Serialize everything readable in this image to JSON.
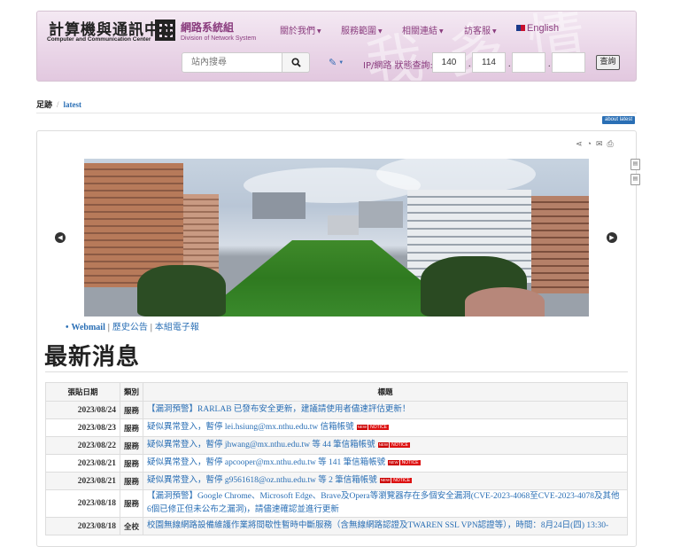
{
  "header": {
    "logo_zh": "計算機與通訊中心",
    "logo_en": "Computer and Communication Center",
    "division_zh": "網路系統組",
    "division_en": "Division of Network System",
    "watermark": "我 多 情",
    "nav": [
      {
        "label": "關於我們",
        "icon": "caret-down-icon"
      },
      {
        "label": "服務範圍",
        "icon": "caret-down-icon"
      },
      {
        "label": "相關連結",
        "icon": "caret-down-icon"
      },
      {
        "label": "訪客服",
        "icon": "caret-down-icon"
      },
      {
        "label": "English",
        "icon": "uk-flag-icon"
      }
    ],
    "search": {
      "placeholder": "站內搜尋",
      "icon": "search-icon"
    },
    "tools_icon": "wrench-icon",
    "ip_query": {
      "label": "IP/網路 狀態查詢:",
      "octets": [
        "140",
        "114",
        "",
        ""
      ],
      "button": "查詢"
    }
  },
  "breadcrumb": {
    "home": "足跡",
    "current": "latest"
  },
  "about_tag": "about latest",
  "panel": {
    "toolbar_icons": [
      "share-icon",
      "rss-icon",
      "email-icon",
      "print-icon"
    ],
    "side_icons": [
      "pdf-icon",
      "doc-icon"
    ],
    "carousel": {
      "prev_icon": "chevron-left-icon",
      "next_icon": "chevron-right-icon"
    },
    "links": [
      "Webmail",
      "歷史公告",
      "本組電子報"
    ],
    "section_title": "最新消息",
    "table": {
      "headers": [
        "張貼日期",
        "類別",
        "標題"
      ],
      "rows": [
        {
          "date": "2023/08/24",
          "category": "服務",
          "title": "【漏洞預警】RARLAB 已發布安全更新，建議請使用者儘速評估更新！",
          "new": false,
          "notice": false
        },
        {
          "date": "2023/08/23",
          "category": "服務",
          "title": "疑似異常登入，暫停 lei.hsiung@mx.nthu.edu.tw 信箱帳號",
          "new": true,
          "notice": true
        },
        {
          "date": "2023/08/22",
          "category": "服務",
          "title": "疑似異常登入，暫停 jhwang@mx.nthu.edu.tw 等 44 筆信箱帳號",
          "new": true,
          "notice": true
        },
        {
          "date": "2023/08/21",
          "category": "服務",
          "title": "疑似異常登入，暫停 apcooper@mx.nthu.edu.tw 等 141 筆信箱帳號",
          "new": true,
          "notice": true
        },
        {
          "date": "2023/08/21",
          "category": "服務",
          "title": "疑似異常登入，暫停 g9561618@oz.nthu.edu.tw 等 2 筆信箱帳號",
          "new": true,
          "notice": true
        },
        {
          "date": "2023/08/18",
          "category": "服務",
          "title": "【漏洞預警】Google Chrome、Microsoft Edge、Brave及Opera等瀏覽器存在多個安全漏洞(CVE-2023-4068至CVE-2023-4078及其他6個已修正但未公布之漏洞)，請儘速確認並進行更新",
          "new": false,
          "notice": false
        },
        {
          "date": "2023/08/18",
          "category": "全校",
          "title": "校園無線網路設備維護作業將間歇性暫時中斷服務（含無線網路認證及TWAREN SSL VPN認證等），時間：8月24日(四) 13:30-",
          "new": false,
          "notice": false
        }
      ],
      "badge_new": "NEW",
      "badge_notice": "NOTICE"
    }
  }
}
